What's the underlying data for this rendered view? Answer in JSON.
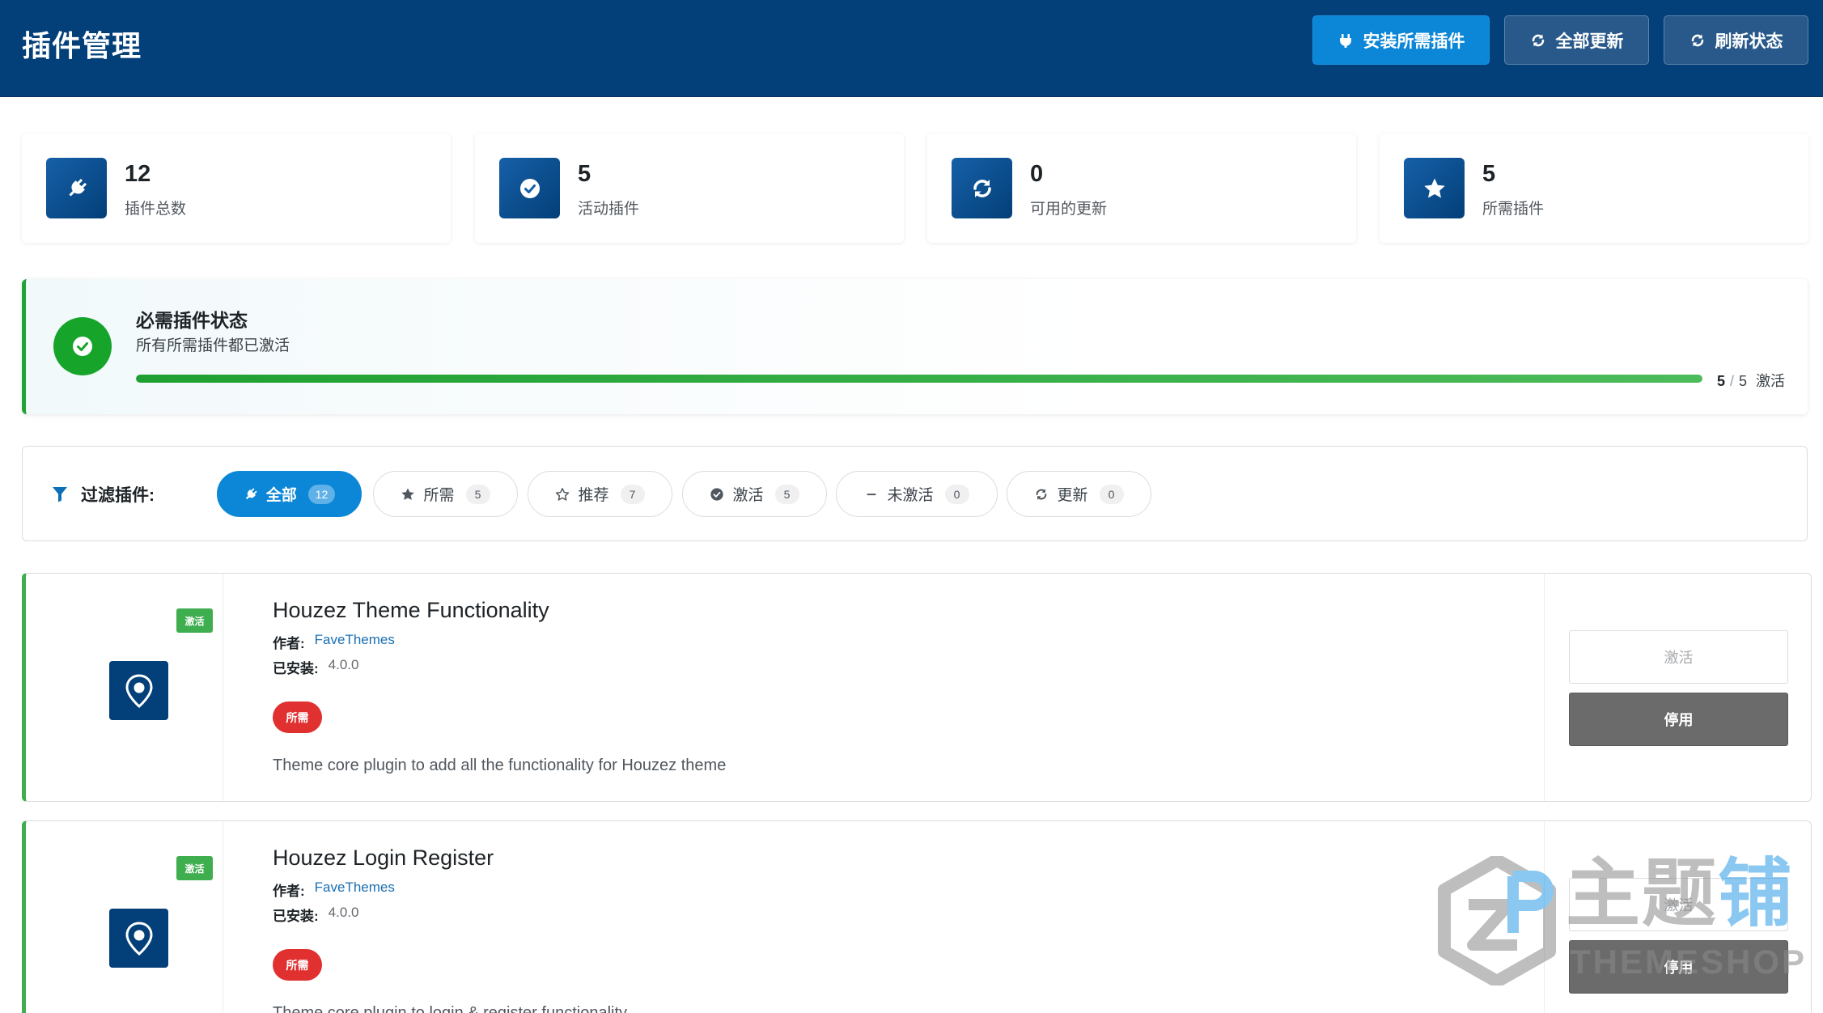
{
  "header": {
    "title": "插件管理",
    "buttons": {
      "install_required": "安装所需插件",
      "update_all": "全部更新",
      "refresh_status": "刷新状态"
    }
  },
  "stats": [
    {
      "value": "12",
      "label": "插件总数",
      "icon": "plug-icon"
    },
    {
      "value": "5",
      "label": "活动插件",
      "icon": "check-circle-icon"
    },
    {
      "value": "0",
      "label": "可用的更新",
      "icon": "sync-icon"
    },
    {
      "value": "5",
      "label": "所需插件",
      "icon": "star-icon"
    }
  ],
  "required_status": {
    "title": "必需插件状态",
    "subtitle": "所有所需插件都已激活",
    "active": "5",
    "separator": "/",
    "total": "5",
    "suffix": "激活",
    "progress_percent": 100,
    "color": "#16a42b"
  },
  "filter": {
    "label": "过滤插件:",
    "pills": [
      {
        "label": "全部",
        "count": "12",
        "icon": "plug-icon",
        "active": true
      },
      {
        "label": "所需",
        "count": "5",
        "icon": "star-icon",
        "active": false
      },
      {
        "label": "推荐",
        "count": "7",
        "icon": "star-outline-icon",
        "active": false
      },
      {
        "label": "激活",
        "count": "5",
        "icon": "check-circle-icon",
        "active": false
      },
      {
        "label": "未激活",
        "count": "0",
        "icon": "minus-icon",
        "active": false
      },
      {
        "label": "更新",
        "count": "0",
        "icon": "sync-icon",
        "active": false
      }
    ]
  },
  "plugins": [
    {
      "status_badge": "激活",
      "name": "Houzez Theme Functionality",
      "author_label": "作者:",
      "author": "FaveThemes",
      "installed_label": "已安装:",
      "version": "4.0.0",
      "tag": "所需",
      "description": "Theme core plugin to add all the functionality for Houzez theme",
      "activate_label": "激活",
      "deactivate_label": "停用"
    },
    {
      "status_badge": "激活",
      "name": "Houzez Login Register",
      "author_label": "作者:",
      "author": "FaveThemes",
      "installed_label": "已安装:",
      "version": "4.0.0",
      "tag": "所需",
      "description": "Theme core plugin to login & register functionality",
      "activate_label": "激活",
      "deactivate_label": "停用"
    }
  ],
  "watermark": {
    "cn_gray": "主题",
    "cn_blue": "铺",
    "en": "THEMESHOP"
  },
  "colors": {
    "header_bg": "#033f78",
    "primary": "#0c86d6",
    "success": "#16a42b",
    "danger": "#e03030",
    "active_badge": "#3fae4f"
  }
}
